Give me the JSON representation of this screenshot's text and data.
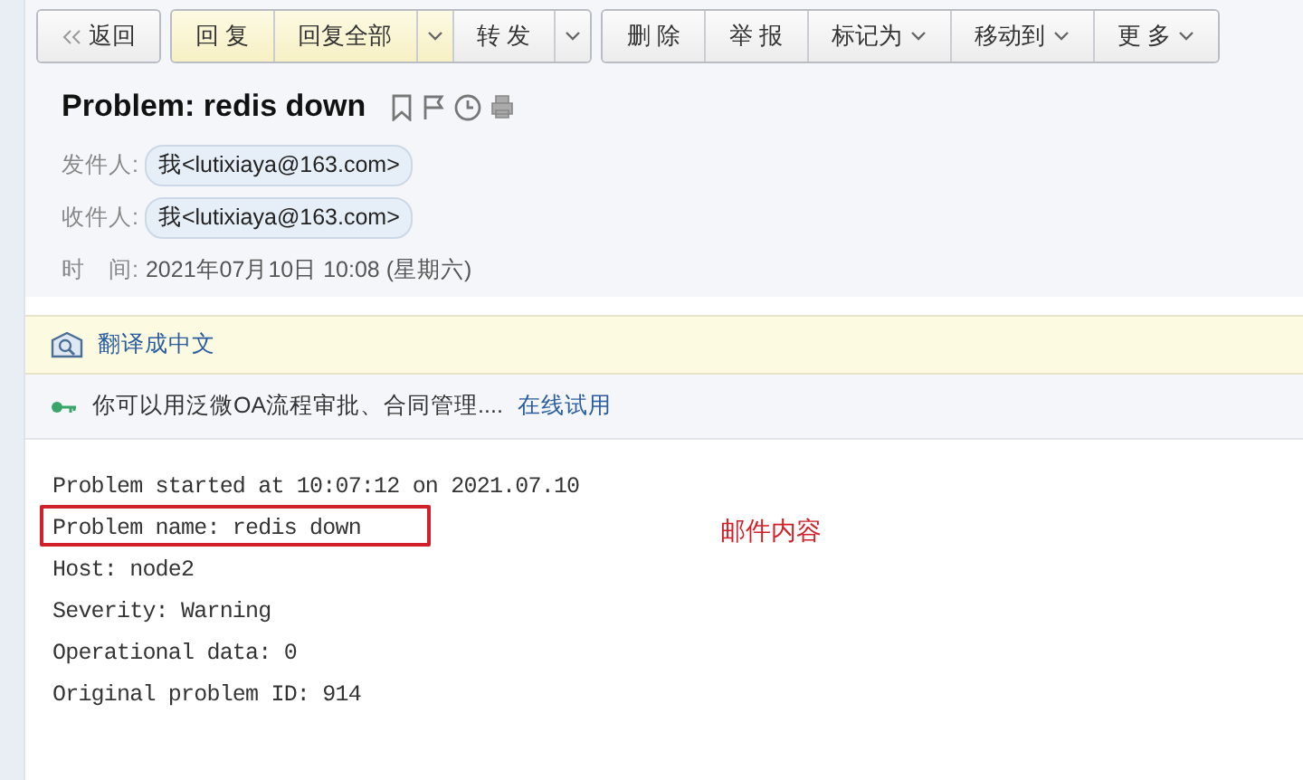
{
  "toolbar": [
    {
      "buttons": [
        {
          "kind": "back",
          "label": "返回",
          "highlight": false
        }
      ]
    },
    {
      "buttons": [
        {
          "kind": "plain",
          "label": "回 复",
          "highlight": true
        },
        {
          "kind": "plain",
          "label": "回复全部",
          "highlight": true
        },
        {
          "kind": "caret",
          "highlight": true
        },
        {
          "kind": "plain",
          "label": "转 发",
          "highlight": false
        },
        {
          "kind": "caret",
          "highlight": false
        }
      ]
    },
    {
      "buttons": [
        {
          "kind": "plain",
          "label": "删 除",
          "highlight": false
        },
        {
          "kind": "plain",
          "label": "举 报",
          "highlight": false
        },
        {
          "kind": "menu",
          "label": "标记为",
          "highlight": false
        },
        {
          "kind": "menu",
          "label": "移动到",
          "highlight": false
        },
        {
          "kind": "menu",
          "label": "更 多",
          "highlight": false
        }
      ]
    }
  ],
  "subject": "Problem: redis down",
  "fields": [
    {
      "kind": "contact",
      "label": "发件人:",
      "value": "我<lutixiaya@163.com>"
    },
    {
      "kind": "contact",
      "label": "收件人:",
      "value": "我<lutixiaya@163.com>"
    },
    {
      "kind": "text",
      "label": "时　间:",
      "value": "2021年07月10日 10:08 (星期六)"
    }
  ],
  "translate": {
    "label": "翻译成中文"
  },
  "promo": {
    "text": "你可以用泛微OA流程审批、合同管理....",
    "link": "在线试用"
  },
  "body": [
    {
      "text": "Problem started at 10:07:12 on 2021.07.10",
      "boxed": false
    },
    {
      "text": "Problem name: redis down",
      "boxed": true
    },
    {
      "text": "Host: node2",
      "boxed": false
    },
    {
      "text": "Severity: Warning",
      "boxed": false
    },
    {
      "text": "Operational data: 0",
      "boxed": false
    },
    {
      "text": "Original problem ID: 914",
      "boxed": false
    }
  ],
  "annotation": "邮件内容"
}
